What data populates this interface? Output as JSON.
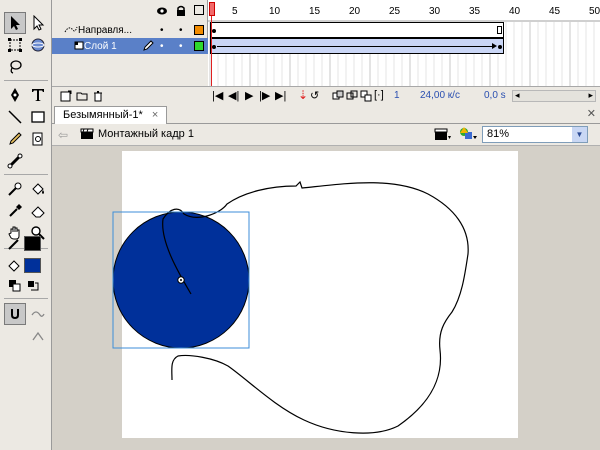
{
  "timeline": {
    "layers": [
      {
        "name": "Направля..."
      },
      {
        "name": "Слой 1"
      }
    ],
    "ruler": [
      "5",
      "10",
      "15",
      "20",
      "25",
      "30",
      "35",
      "40",
      "45",
      "50"
    ],
    "current_frame": "1",
    "fps": "24,00 к/с",
    "time": "0,0 s"
  },
  "document": {
    "tab_title": "Безымянный-1*",
    "scene_name": "Монтажный кадр 1",
    "zoom": "81%"
  },
  "colors": {
    "stroke": "#000000",
    "fill": "#00309a",
    "selection": "#3c8ed8",
    "layer_selected": "#5a80c8",
    "playhead": "#e02020"
  },
  "icons": [
    "arrow-icon",
    "subselect-icon",
    "free-transform-icon",
    "3d-rotate-icon",
    "lasso-icon",
    "pen-icon",
    "text-icon",
    "line-icon",
    "rectangle-icon",
    "pencil-icon",
    "brush-icon",
    "deco-icon",
    "bone-icon",
    "paint-bucket-icon",
    "eyedropper-icon",
    "eraser-icon",
    "hand-icon",
    "zoom-icon"
  ]
}
